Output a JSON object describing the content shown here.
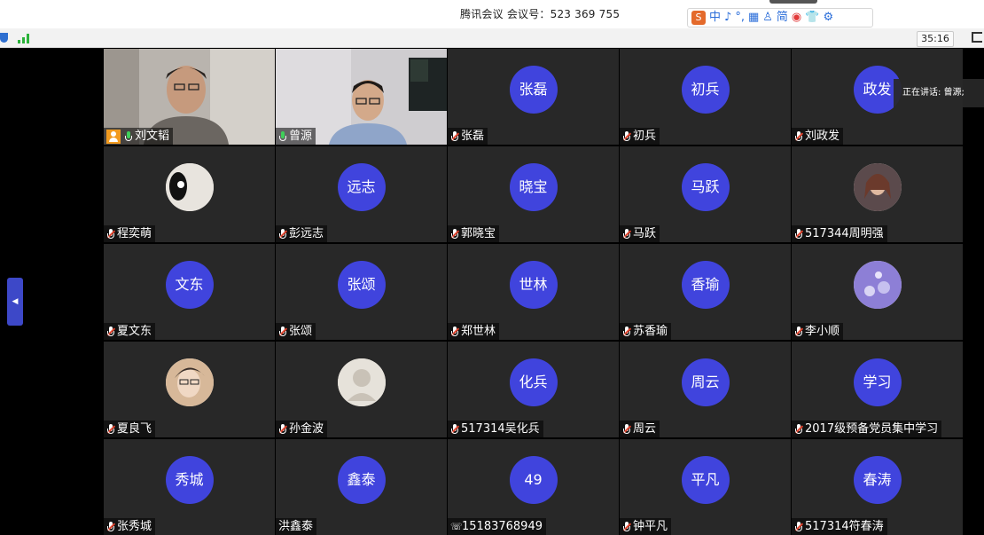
{
  "window": {
    "title": "腾讯会议 会议号：523 369 755"
  },
  "ime": {
    "items": [
      "中",
      "♪",
      "°,",
      "▦",
      "♙",
      "简",
      "◉",
      "👕",
      "⚙"
    ]
  },
  "toolbar": {
    "timer": "35:16"
  },
  "speaking": {
    "text": "正在讲话: 曾源;"
  },
  "tiles": [
    {
      "name": "刘文韬",
      "type": "video",
      "host": true,
      "mic": "active"
    },
    {
      "name": "曾源",
      "type": "video",
      "mic": "active",
      "active": true
    },
    {
      "name": "张磊",
      "avatar": "张磊",
      "mic": "muted"
    },
    {
      "name": "初兵",
      "avatar": "初兵",
      "mic": "muted"
    },
    {
      "name": "刘政发",
      "avatar": "政发",
      "mic": "muted"
    },
    {
      "name": "程奕萌",
      "avatar_photo": "panda",
      "mic": "muted"
    },
    {
      "name": "彭远志",
      "avatar": "远志",
      "mic": "muted"
    },
    {
      "name": "郭晓宝",
      "avatar": "晓宝",
      "mic": "muted"
    },
    {
      "name": "马跃",
      "avatar": "马跃",
      "mic": "muted"
    },
    {
      "name": "517344周明强",
      "avatar_photo": "portrait",
      "mic": "muted"
    },
    {
      "name": "夏文东",
      "avatar": "文东",
      "mic": "muted"
    },
    {
      "name": "张颂",
      "avatar": "张颂",
      "mic": "muted"
    },
    {
      "name": "郑世林",
      "avatar": "世林",
      "mic": "muted"
    },
    {
      "name": "苏香瑜",
      "avatar": "香瑜",
      "mic": "muted"
    },
    {
      "name": "李小顺",
      "avatar_photo": "bubbles",
      "mic": "muted"
    },
    {
      "name": "夏良飞",
      "avatar_photo": "face",
      "mic": "muted"
    },
    {
      "name": "孙金波",
      "avatar_photo": "default",
      "mic": "muted"
    },
    {
      "name": "517314吴化兵",
      "avatar": "化兵",
      "mic": "muted"
    },
    {
      "name": "周云",
      "avatar": "周云",
      "mic": "muted"
    },
    {
      "name": "2017级预备党员集中学习",
      "avatar": "学习",
      "mic": "muted"
    },
    {
      "name": "张秀城",
      "avatar": "秀城",
      "mic": "muted"
    },
    {
      "name": "洪鑫泰",
      "avatar": "鑫泰",
      "mic": "none"
    },
    {
      "name": "15183768949",
      "avatar": "49",
      "mic": "phone"
    },
    {
      "name": "钟平凡",
      "avatar": "平凡",
      "mic": "muted"
    },
    {
      "name": "517314符春涛",
      "avatar": "春涛",
      "mic": "muted"
    }
  ],
  "colors": {
    "avatar_bg": "#4044dd",
    "tile_bg": "#282828",
    "active_border": "#1ea64a"
  }
}
